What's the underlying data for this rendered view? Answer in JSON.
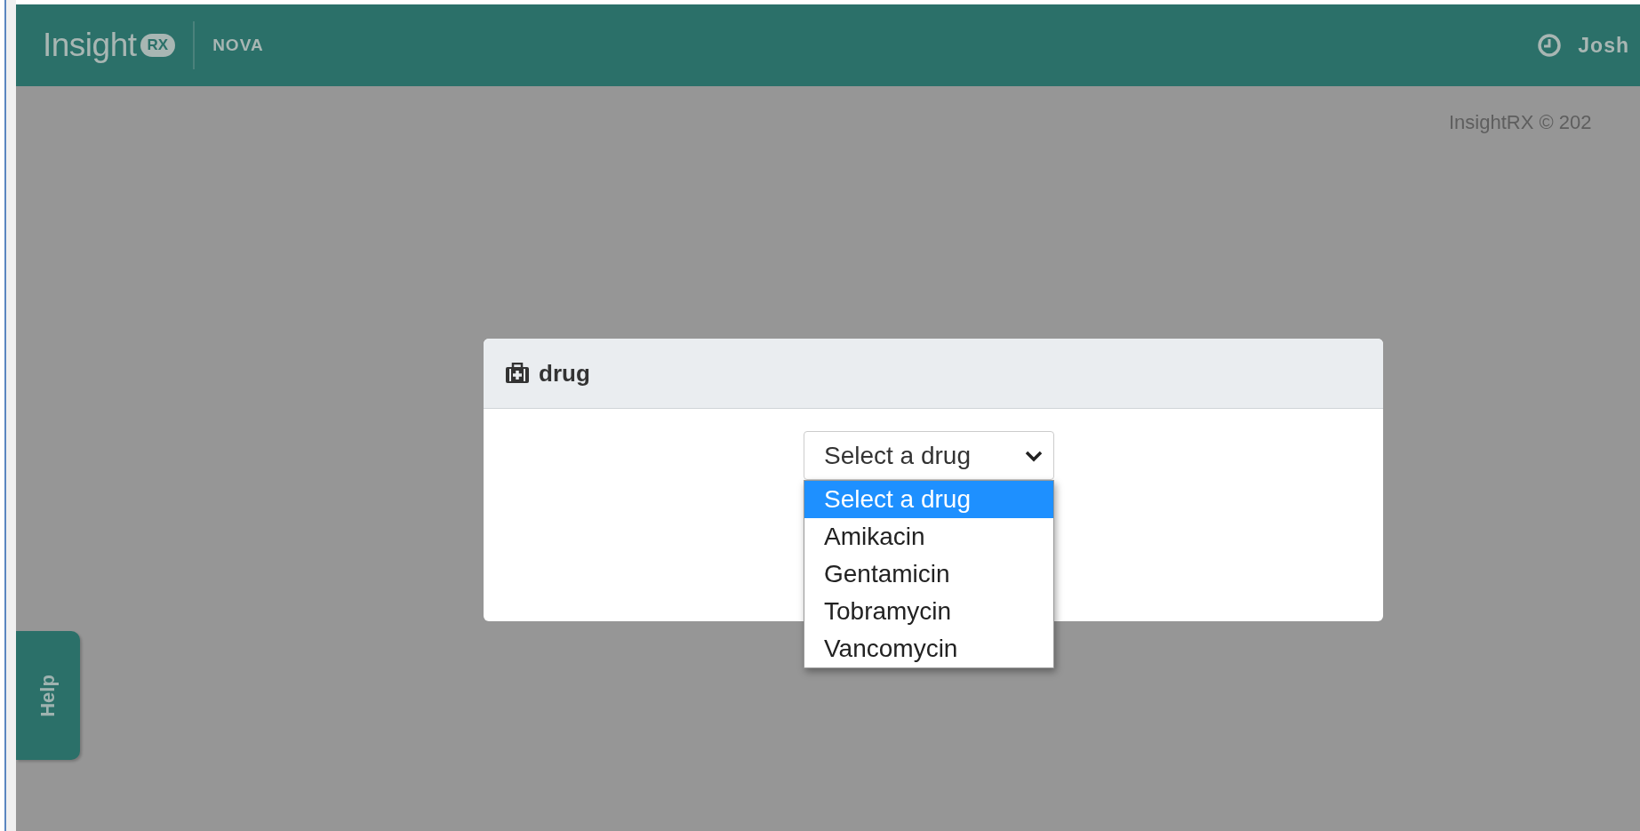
{
  "header": {
    "logo": {
      "name": "Insight",
      "badge": "RX"
    },
    "product": "NOVA",
    "user": "Josh"
  },
  "copyright": "InsightRX © 202",
  "help_tab": "Help",
  "dialog": {
    "title": "drug",
    "select": {
      "value": "Select a drug",
      "expanded": true,
      "options": [
        {
          "label": "Select a drug",
          "selected": true
        },
        {
          "label": "Amikacin",
          "selected": false
        },
        {
          "label": "Gentamicin",
          "selected": false
        },
        {
          "label": "Tobramycin",
          "selected": false
        },
        {
          "label": "Vancomycin",
          "selected": false
        }
      ]
    }
  }
}
